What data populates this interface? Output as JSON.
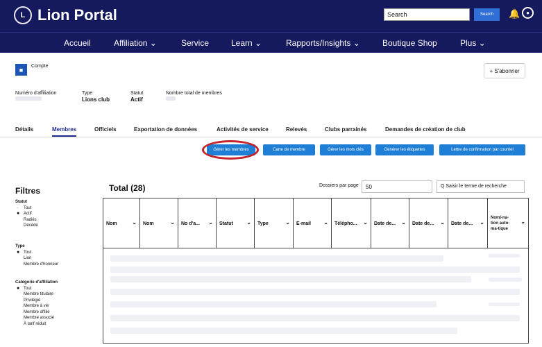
{
  "header": {
    "brand": "Lion Portal",
    "logo_text": "L",
    "search_placeholder": "Search",
    "search_button": "Search",
    "bell_icon": "bell-icon",
    "user_icon": "user-icon"
  },
  "nav": {
    "items": [
      {
        "label": "Accueil"
      },
      {
        "label": "Affiliation ⌄"
      },
      {
        "label": "Service"
      },
      {
        "label": "Learn ⌄"
      },
      {
        "label": "Rapports/Insights ⌄"
      },
      {
        "label": "Boutique Shop"
      },
      {
        "label": "Plus ⌄"
      }
    ]
  },
  "record": {
    "type_label": "Compte",
    "follow_button": "+ S'abonner",
    "fields": [
      {
        "label": "Numéro d'affiliation",
        "value": ""
      },
      {
        "label": "Type",
        "value": "Lions club"
      },
      {
        "label": "Statut",
        "value": "Actif"
      },
      {
        "label": "Nombre total de membres",
        "value": ""
      }
    ]
  },
  "tabs": [
    {
      "label": "Détails"
    },
    {
      "label": "Membres"
    },
    {
      "label": "Officiels"
    },
    {
      "label": "Exportation de données"
    },
    {
      "label": "Activités de service"
    },
    {
      "label": "Relevés"
    },
    {
      "label": "Clubs parrainés"
    },
    {
      "label": "Demandes de création de club"
    }
  ],
  "actions": [
    {
      "label": "Gérer les membres"
    },
    {
      "label": "Carte de membre"
    },
    {
      "label": "Gérer les mots clés"
    },
    {
      "label": "Générer les étiquettes"
    },
    {
      "label": "Lettre de confirmation par courriel"
    }
  ],
  "filters": {
    "title": "Filtres",
    "groups": [
      {
        "heading": "Statut",
        "options": [
          "Tout",
          "Actif",
          "Radiés",
          "Décédé"
        ],
        "selected": 1
      },
      {
        "heading": "Type",
        "options": [
          "Tout",
          "Lion",
          "Membre d'honneur"
        ],
        "selected": 0
      },
      {
        "heading": "Catégorie d'affiliation",
        "options": [
          "Tout",
          "Membre titulaire",
          "Privilégié",
          "Membre à vie",
          "Membre affilié",
          "Membre associé",
          "À tarif réduit"
        ],
        "selected": 0
      }
    ]
  },
  "list": {
    "total": "Total (28)",
    "per_page_label": "Dossiers par page",
    "per_page_value": "50",
    "search_placeholder": "Q  Saisir le terme de recherche"
  },
  "table": {
    "columns": [
      {
        "label": "Nom"
      },
      {
        "label": "Nom"
      },
      {
        "label": "No d'a..."
      },
      {
        "label": "Statut"
      },
      {
        "label": "Type"
      },
      {
        "label": "E-mail"
      },
      {
        "label": "Télépho..."
      },
      {
        "label": "Date de..."
      },
      {
        "label": "Date de..."
      },
      {
        "label": "Date de..."
      },
      {
        "label": "Nomi-na-tion auto-ma-tique"
      }
    ]
  }
}
